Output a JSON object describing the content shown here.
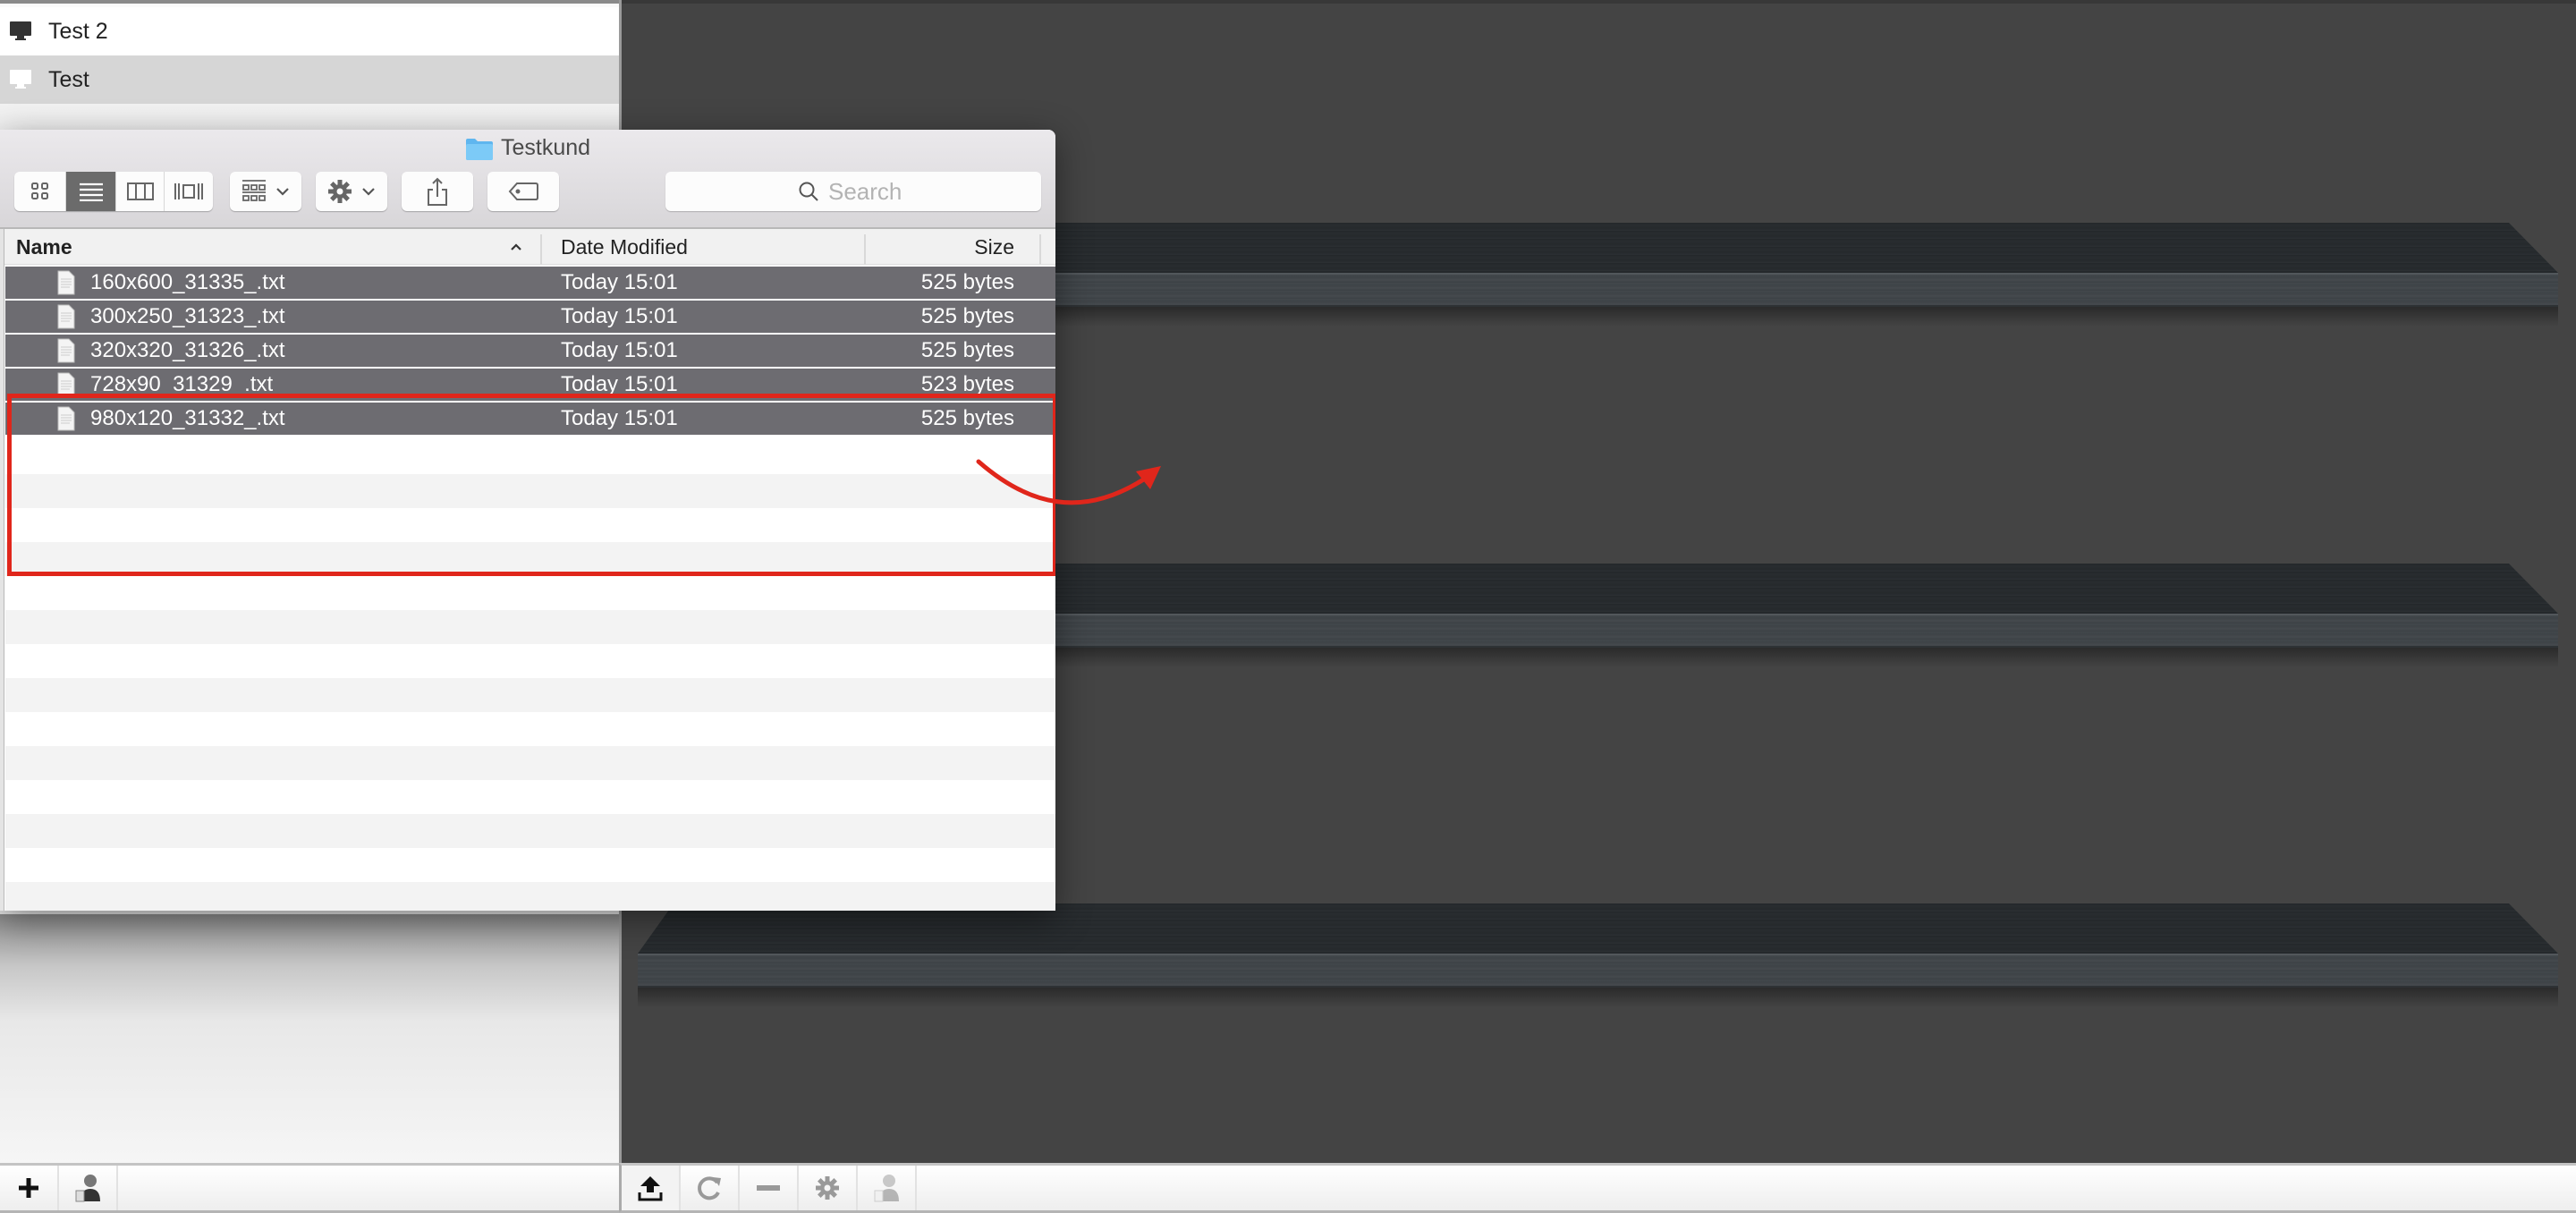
{
  "sidebar": {
    "items": [
      {
        "label": "Test 2",
        "icon": "monitor-icon",
        "selected": false
      },
      {
        "label": "Test",
        "icon": "monitor-icon",
        "selected": true
      }
    ]
  },
  "finder": {
    "title": "Testkund",
    "title_icon": "folder-icon",
    "toolbar": {
      "view_modes": [
        {
          "name": "icon-view",
          "icon": "grid-icon",
          "active": false
        },
        {
          "name": "list-view",
          "icon": "list-icon",
          "active": true
        },
        {
          "name": "column-view",
          "icon": "columns-icon",
          "active": false
        },
        {
          "name": "cover-flow-view",
          "icon": "coverflow-icon",
          "active": false
        }
      ],
      "arrange_icon": "arrange-icon",
      "action_icon": "gear-icon",
      "share_icon": "share-icon",
      "tag_icon": "tag-icon",
      "search_placeholder": "Search",
      "search_value": ""
    },
    "columns": {
      "name": "Name",
      "date": "Date Modified",
      "size": "Size",
      "sort_indicator": "^"
    },
    "files": [
      {
        "name": "160x600_31335_.txt",
        "date": "Today 15:01",
        "size": "525 bytes",
        "selected": true
      },
      {
        "name": "300x250_31323_.txt",
        "date": "Today 15:01",
        "size": "525 bytes",
        "selected": true
      },
      {
        "name": "320x320_31326_.txt",
        "date": "Today 15:01",
        "size": "525 bytes",
        "selected": true
      },
      {
        "name": "728x90_31329_.txt",
        "date": "Today 15:01",
        "size": "523 bytes",
        "selected": true
      },
      {
        "name": "980x120_31332_.txt",
        "date": "Today 15:01",
        "size": "525 bytes",
        "selected": true
      }
    ]
  },
  "annotation": {
    "highlight_color": "#e0261b",
    "arrow_direction": "drag files onto shelf"
  },
  "shelves": {
    "count": 3
  },
  "bottom_left_bar": {
    "buttons": [
      {
        "name": "add-button",
        "icon": "plus-icon",
        "enabled": true
      },
      {
        "name": "assign-user-button",
        "icon": "user-clipboard-icon",
        "enabled": true
      }
    ]
  },
  "bottom_right_bar": {
    "buttons": [
      {
        "name": "upload-button",
        "icon": "upload-icon",
        "enabled": true
      },
      {
        "name": "refresh-button",
        "icon": "refresh-icon",
        "enabled": false
      },
      {
        "name": "remove-button",
        "icon": "minus-icon",
        "enabled": false
      },
      {
        "name": "settings-button",
        "icon": "gear-icon",
        "enabled": false
      },
      {
        "name": "assign-user-button",
        "icon": "user-clipboard-icon",
        "enabled": false
      }
    ]
  },
  "colors": {
    "selection_row": "#6d6c71",
    "sidebar_selected": "#d6d6d6",
    "shelf_background": "#444444",
    "highlight_red": "#e0261b"
  }
}
